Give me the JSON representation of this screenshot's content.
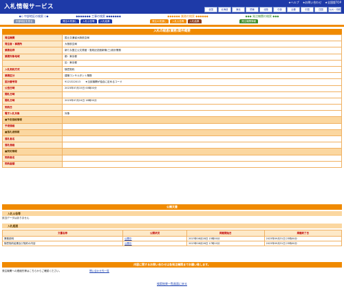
{
  "header": {
    "title": "入札情報サービス",
    "links": [
      "★ヘルプ",
      "★お問い合わせ",
      "★全国版TOP"
    ],
    "regions": [
      "全国",
      "北海道",
      "東北",
      "関東",
      "北陸",
      "中部",
      "近畿",
      "中国",
      "四国",
      "九州・沖縄"
    ]
  },
  "nav": {
    "groups": [
      {
        "title": "◆◇ 中部地区の検索 ◇◆",
        "tabs": [
          {
            "label": "中部地区を見る",
            "color": "gray"
          }
        ]
      },
      {
        "title": "◆◆◆◆◆◆◆ 工事の検索 ◆◆◆◆◆◆◆",
        "tabs": [
          {
            "label": "発注の見通し",
            "color": "dark"
          },
          {
            "label": "入札公告等",
            "color": "dark"
          },
          {
            "label": "入札結果",
            "color": "dark"
          }
        ]
      },
      {
        "title": "◆◆◆◆◆◆ 業務の検索 ◆◆◆◆◆◆",
        "tabs": [
          {
            "label": "発注の見通し",
            "color": "orange"
          },
          {
            "label": "入札公告等",
            "color": "orange"
          },
          {
            "label": "入札結果",
            "color": "brown"
          }
        ]
      },
      {
        "title": "◆◆◆ 発注機関の検索 ◆◆◆",
        "tabs": [
          {
            "label": "発注機関情報",
            "color": "green"
          }
        ]
      }
    ]
  },
  "detail": {
    "title": "入札の経過(業務)案件概要",
    "rows": [
      {
        "label": "発注機関",
        "value": "国土交通省大阪航空局"
      },
      {
        "label": "発注者・事務所",
        "value": "大阪航空局"
      },
      {
        "label": "業務名称",
        "value": "新たな国立公文書館・憲政記念館新築(三)設計業務"
      },
      {
        "label": "業務対象地域",
        "value": "都：東京都"
      },
      {
        "label": "",
        "value": "区：東京都"
      },
      {
        "label": "入札契約方式",
        "value": "随意契約"
      },
      {
        "label": "業務区分",
        "value": "建築コンサルタント業務"
      },
      {
        "label": "設計番号等",
        "value": "9121322013　　★当該機関が独自に定めるコード"
      },
      {
        "label": "公告日時",
        "value": "2023年07月15日 00時00分"
      },
      {
        "label": "開札日時",
        "value": ""
      },
      {
        "label": "開札日時",
        "value": "2023年07月24日 16時00分"
      },
      {
        "label": "契約日",
        "value": ""
      },
      {
        "label": "電子入札対象",
        "value": "対象"
      },
      {
        "label": "■予定価格情報",
        "value": "",
        "sub": true
      },
      {
        "label": "予定価格",
        "value": ""
      },
      {
        "label": "■落札者情報",
        "value": "",
        "sub": true
      },
      {
        "label": "落札者名",
        "value": ""
      },
      {
        "label": "落札価格",
        "value": ""
      },
      {
        "label": "■契約情報",
        "value": "",
        "sub": true
      },
      {
        "label": "契約者名",
        "value": ""
      },
      {
        "label": "契約金額",
        "value": ""
      }
    ]
  },
  "docs": {
    "title": "公開文書",
    "sub1": "入札公告等",
    "empty": "該当データはありません",
    "sub2": "入札経過",
    "columns": [
      "文書名称",
      "公開状況",
      "掲載開始日",
      "掲載終了日"
    ],
    "rows": [
      {
        "name": "業務説明",
        "status": "公開中",
        "start": "2023年08月28日 15時00分",
        "end": "2023年09月31日 23時00分"
      },
      {
        "name": "随意契約結果及び契約の内容",
        "status": "公開中",
        "start": "2023年08月26日 17時10分",
        "end": "2023年09月31日 23時00分"
      }
    ]
  },
  "contact": {
    "banner": "内容に関するお問い合わせは各発注機関までお願い致します。",
    "text": "発注機関への連絡先等はこちらからご確認ください。",
    "link": "問い合わせ先一覧"
  },
  "footer": {
    "back": "検索結果一覧画面に戻る"
  }
}
